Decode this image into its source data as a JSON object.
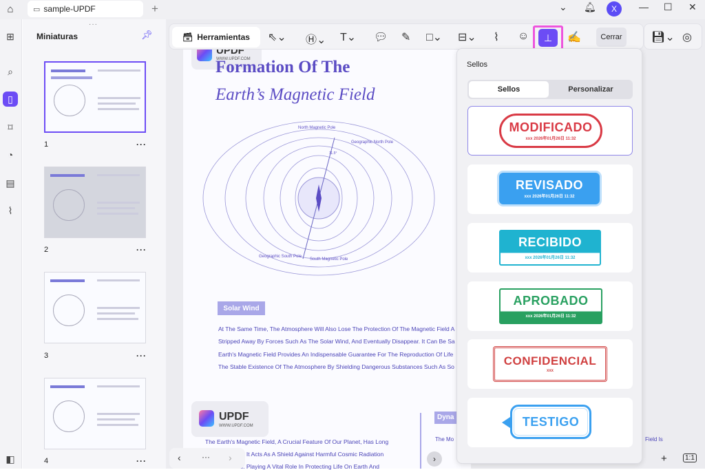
{
  "titlebar": {
    "tab_title": "sample-UPDF",
    "avatar_letter": "X"
  },
  "thumbnails": {
    "header": "Miniaturas",
    "pages": [
      {
        "num": "1"
      },
      {
        "num": "2"
      },
      {
        "num": "3"
      },
      {
        "num": "4"
      }
    ],
    "more": "···"
  },
  "toolbar": {
    "tools_label": "Herramientas",
    "close_label": "Cerrar"
  },
  "doc": {
    "title": "Formation Of The",
    "subtitle": "Earth’s Magnetic Field",
    "diagram": {
      "north_magnetic": "North Magnetic Pole",
      "north_geo": "Geographic North Pole",
      "south_geo": "Geographic South Pole",
      "south_magnetic": "South Magnetic Pole",
      "angle": "11.5°"
    },
    "solar_wind": "Solar Wind",
    "paragraph": [
      "At The Same Time, The Atmosphere Will Also Lose The Protection Of The Magnetic Field A",
      "Stripped Away By Forces Such As The Solar Wind, And Eventually Disappear. It Can Be Sa",
      "Earth's Magnetic Field Provides An Indispensable Guarantee For The Reproduction Of Life",
      "The Stable Existence Of The Atmosphere By Shielding Dangerous Substances Such As So"
    ],
    "logo_text": "UPDF",
    "logo_url": "WWW.UPDF.COM",
    "page2_lines": [
      "The Earth's Magnetic Field, A Crucial Feature Of Our Planet, Has Long",
      "tists. It Acts As A Shield Against Harmful Cosmic Radiation",
      "cles. Playing A Vital Role In Protecting Life On Earth And"
    ],
    "dyna": "Dyna",
    "right_snip": "The Mo",
    "right_snip2": "Field Is"
  },
  "stamps_panel": {
    "title": "Sellos",
    "tab_active": "Sellos",
    "tab_other": "Personalizar",
    "stamps": [
      {
        "word": "MODIFICADO",
        "date": "xxx 2026年01月26日 11:32",
        "color": "#d93a45"
      },
      {
        "word": "REVISADO",
        "date": "xxx 2026年01月26日 11:32",
        "color": "#3aa0f0"
      },
      {
        "word": "RECIBIDO",
        "date": "xxx 2026年01月26日 11:32",
        "color": "#1fb3d0"
      },
      {
        "word": "APROBADO",
        "date": "xxx 2026年01月26日 11:32",
        "color": "#28a060"
      },
      {
        "word": "CONFIDENCIAL",
        "date": "xxx",
        "color": "#d04040"
      },
      {
        "word": "TESTIGO",
        "date": "",
        "color": "#3aa0f0"
      }
    ]
  }
}
